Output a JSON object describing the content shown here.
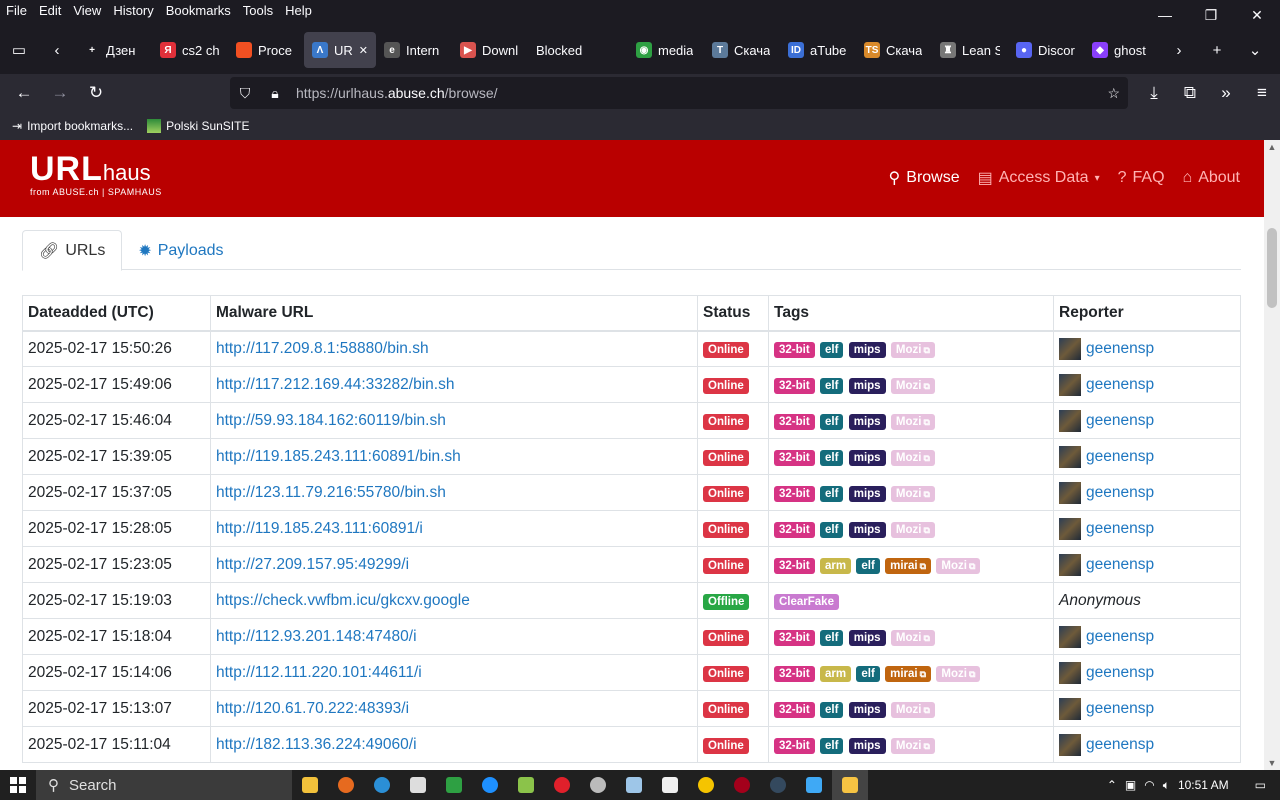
{
  "menubar": {
    "items": [
      "File",
      "Edit",
      "View",
      "History",
      "Bookmarks",
      "Tools",
      "Help"
    ]
  },
  "tabs": [
    {
      "label": "Дзен",
      "color": "#1c1b22",
      "glyph": "+"
    },
    {
      "label": "cs2 ch",
      "color": "#e0303a",
      "glyph": "Я"
    },
    {
      "label": "Proce",
      "color": "#f25022",
      "glyph": ""
    },
    {
      "label": "URL",
      "color": "#3a78c9",
      "glyph": "Λ"
    },
    {
      "label": "Intern",
      "color": "#555555",
      "glyph": "e"
    },
    {
      "label": "Downl",
      "color": "#d9534f",
      "glyph": "▶"
    },
    {
      "label": "Blocked",
      "color": "",
      "glyph": ""
    },
    {
      "label": "media",
      "color": "#2ea043",
      "glyph": "◉"
    },
    {
      "label": "Скача",
      "color": "#5c7a9a",
      "glyph": "T"
    },
    {
      "label": "aTube",
      "color": "#3b6fd6",
      "glyph": "ID"
    },
    {
      "label": "Скача",
      "color": "#d98a2b",
      "glyph": "TS"
    },
    {
      "label": "Lean S",
      "color": "#777777",
      "glyph": "♜"
    },
    {
      "label": "Discor",
      "color": "#5865f2",
      "glyph": "●"
    },
    {
      "label": "ghost",
      "color": "#8a3ffc",
      "glyph": "◆"
    }
  ],
  "address": {
    "prefix": "https://urlhaus.",
    "domain": "abuse.ch",
    "path": "/browse/"
  },
  "bookmarks": [
    {
      "label": "Import bookmarks..."
    },
    {
      "label": "Polski SunSITE"
    }
  ],
  "site": {
    "logo_big": "URL",
    "logo_small": "haus",
    "logo_sub": "from ABUSE.ch | SPAMHAUS",
    "nav": [
      "Browse",
      "Access Data",
      "FAQ",
      "About"
    ]
  },
  "content_tabs": [
    "URLs",
    "Payloads"
  ],
  "table": {
    "headers": [
      "Dateadded (UTC)",
      "Malware URL",
      "Status",
      "Tags",
      "Reporter"
    ],
    "rows": [
      {
        "date": "2025-02-17 15:50:26",
        "url": "http://117.209.8.1:58880/bin.sh",
        "status": "Online",
        "tags": [
          "32-bit",
          "elf",
          "mips",
          "Mozi"
        ],
        "reporter": "geenensp"
      },
      {
        "date": "2025-02-17 15:49:06",
        "url": "http://117.212.169.44:33282/bin.sh",
        "status": "Online",
        "tags": [
          "32-bit",
          "elf",
          "mips",
          "Mozi"
        ],
        "reporter": "geenensp"
      },
      {
        "date": "2025-02-17 15:46:04",
        "url": "http://59.93.184.162:60119/bin.sh",
        "status": "Online",
        "tags": [
          "32-bit",
          "elf",
          "mips",
          "Mozi"
        ],
        "reporter": "geenensp"
      },
      {
        "date": "2025-02-17 15:39:05",
        "url": "http://119.185.243.111:60891/bin.sh",
        "status": "Online",
        "tags": [
          "32-bit",
          "elf",
          "mips",
          "Mozi"
        ],
        "reporter": "geenensp"
      },
      {
        "date": "2025-02-17 15:37:05",
        "url": "http://123.11.79.216:55780/bin.sh",
        "status": "Online",
        "tags": [
          "32-bit",
          "elf",
          "mips",
          "Mozi"
        ],
        "reporter": "geenensp"
      },
      {
        "date": "2025-02-17 15:28:05",
        "url": "http://119.185.243.111:60891/i",
        "status": "Online",
        "tags": [
          "32-bit",
          "elf",
          "mips",
          "Mozi"
        ],
        "reporter": "geenensp"
      },
      {
        "date": "2025-02-17 15:23:05",
        "url": "http://27.209.157.95:49299/i",
        "status": "Online",
        "tags": [
          "32-bit",
          "arm",
          "elf",
          "mirai",
          "Mozi"
        ],
        "reporter": "geenensp"
      },
      {
        "date": "2025-02-17 15:19:03",
        "url": "https://check.vwfbm.icu/gkcxv.google",
        "status": "Offline",
        "tags": [
          "ClearFake"
        ],
        "reporter": "Anonymous"
      },
      {
        "date": "2025-02-17 15:18:04",
        "url": "http://112.93.201.148:47480/i",
        "status": "Online",
        "tags": [
          "32-bit",
          "elf",
          "mips",
          "Mozi"
        ],
        "reporter": "geenensp"
      },
      {
        "date": "2025-02-17 15:14:06",
        "url": "http://112.111.220.101:44611/i",
        "status": "Online",
        "tags": [
          "32-bit",
          "arm",
          "elf",
          "mirai",
          "Mozi"
        ],
        "reporter": "geenensp"
      },
      {
        "date": "2025-02-17 15:13:07",
        "url": "http://120.61.70.222:48393/i",
        "status": "Online",
        "tags": [
          "32-bit",
          "elf",
          "mips",
          "Mozi"
        ],
        "reporter": "geenensp"
      },
      {
        "date": "2025-02-17 15:11:04",
        "url": "http://182.113.36.224:49060/i",
        "status": "Online",
        "tags": [
          "32-bit",
          "elf",
          "mips",
          "Mozi"
        ],
        "reporter": "geenensp"
      }
    ]
  },
  "tag_styles": {
    "32-bit": {
      "bg": "#d63384",
      "fg": "#ffffff",
      "link": false
    },
    "elf": {
      "bg": "#146c7c",
      "fg": "#ffffff",
      "link": false
    },
    "mips": {
      "bg": "#2a1f5c",
      "fg": "#ffffff",
      "link": false
    },
    "Mozi": {
      "bg": "#e7c1de",
      "fg": "#ffffff",
      "link": true
    },
    "arm": {
      "bg": "#c8b84a",
      "fg": "#ffffff",
      "link": false
    },
    "mirai": {
      "bg": "#c0650f",
      "fg": "#ffffff",
      "link": true
    },
    "ClearFake": {
      "bg": "#c97ad0",
      "fg": "#ffffff",
      "link": false
    }
  },
  "taskbar": {
    "search": "Search",
    "time": "10:51 AM"
  }
}
